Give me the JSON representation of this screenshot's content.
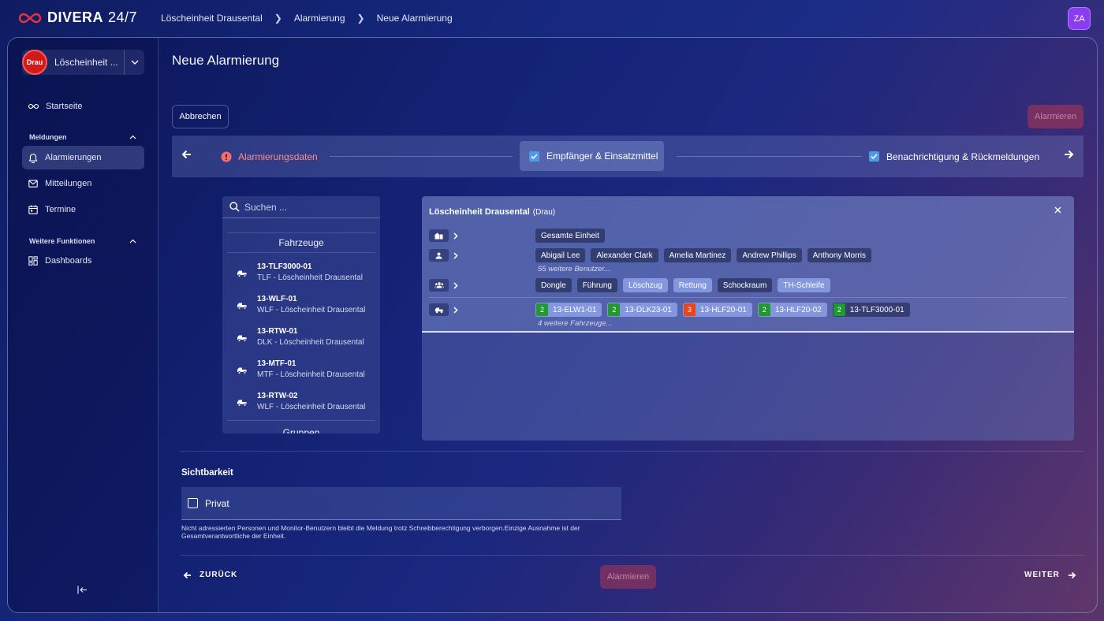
{
  "app": {
    "logo_bold": "DIVERA",
    "logo_thin": "24/7",
    "user_initials": "ZA"
  },
  "breadcrumb": [
    "Löscheinheit Drausental",
    "Alarmierung",
    "Neue Alarmierung"
  ],
  "sidebar": {
    "unit_badge": "Drau",
    "unit_name": "Löscheinheit ...",
    "home": "Startseite",
    "section1": "Meldungen",
    "items1": [
      "Alarmierungen",
      "Mitteilungen",
      "Termine"
    ],
    "section2": "Weitere Funktionen",
    "items2": [
      "Dashboards"
    ]
  },
  "page": {
    "title": "Neue Alarmierung",
    "cancel": "Abbrechen",
    "alarm": "Alarmieren"
  },
  "steps": [
    "Alarmierungsdaten",
    "Empfänger & Einsatzmittel",
    "Benachrichtigung & Rückmeldungen"
  ],
  "picker": {
    "search_placeholder": "Suchen ...",
    "vehicles_head": "Fahrzeuge",
    "vehicles": [
      {
        "name": "13-TLF3000-01",
        "desc": "TLF - Löscheinheit Drausental"
      },
      {
        "name": "13-WLF-01",
        "desc": "WLF - Löscheinheit Drausental"
      },
      {
        "name": "13-RTW-01",
        "desc": "DLK - Löscheinheit Drausental"
      },
      {
        "name": "13-MTF-01",
        "desc": "MTF - Löscheinheit Drausental"
      },
      {
        "name": "13-RTW-02",
        "desc": "WLF - Löscheinheit Drausental"
      }
    ],
    "groups_head": "Gruppen"
  },
  "recipients": {
    "unit_title": "Löscheinheit Drausental",
    "unit_short": "(Drau)",
    "whole_unit": "Gesamte Einheit",
    "users": [
      "Abigail Lee",
      "Alexander Clark",
      "Amelia Martinez",
      "Andrew Phillips",
      "Anthony Morris"
    ],
    "users_more": "55 weitere Benutzer...",
    "groups": [
      "Dongle",
      "Führung",
      "Löschzug",
      "Rettung",
      "Schockraum",
      "TH-Schleife"
    ],
    "vehicles": [
      {
        "status": "2",
        "name": "13-ELW1-01"
      },
      {
        "status": "2",
        "name": "13-DLK23-01"
      },
      {
        "status": "3",
        "name": "13-HLF20-01"
      },
      {
        "status": "2",
        "name": "13-HLF20-02"
      },
      {
        "status": "2",
        "name": "13-TLF3000-01"
      }
    ],
    "vehicles_more": "4 weitere Fahrzeuge..."
  },
  "visibility": {
    "title": "Sichtbarkeit",
    "privat": "Privat",
    "hint": "Nicht adressierten Personen und Monitor-Benutzern bleibt die Meldung trotz Schreibberechtigung verborgen.Einzige Ausnahme ist der Gesamtverantwortliche der Einheit."
  },
  "footer": {
    "back": "ZURÜCK",
    "next": "WEITER",
    "alarm": "Alarmieren"
  },
  "colors": {
    "status_green": "#1e9a2e",
    "status_red": "#e8451e",
    "accent": "#4d9be8",
    "unit_red": "#d31a1a"
  }
}
